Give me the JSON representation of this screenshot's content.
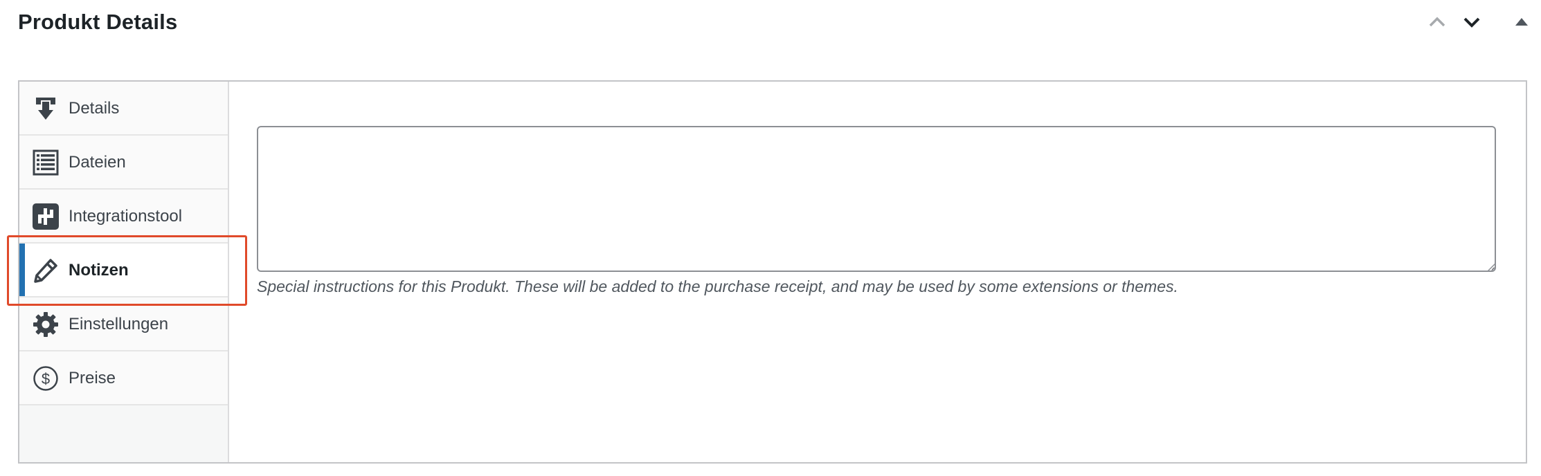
{
  "panel": {
    "title": "Produkt Details"
  },
  "header_controls": {
    "move_up_icon": "chevron-up-icon",
    "move_down_icon": "chevron-down-icon",
    "toggle_icon": "triangle-up-icon"
  },
  "tabs": [
    {
      "label": "Details",
      "icon": "download-icon",
      "active": false
    },
    {
      "label": "Dateien",
      "icon": "list-icon",
      "active": false
    },
    {
      "label": "Integrationstool",
      "icon": "integration-icon",
      "active": false
    },
    {
      "label": "Notizen",
      "icon": "pencil-icon",
      "active": true
    },
    {
      "label": "Einstellungen",
      "icon": "gear-icon",
      "active": false
    },
    {
      "label": "Preise",
      "icon": "dollar-icon",
      "active": false
    }
  ],
  "notes": {
    "value": "",
    "description": "Special instructions for this Produkt. These will be added to the purchase receipt, and may be used by some extensions or themes."
  },
  "colors": {
    "accent": "#2271b1",
    "highlight": "#e04a2a"
  }
}
